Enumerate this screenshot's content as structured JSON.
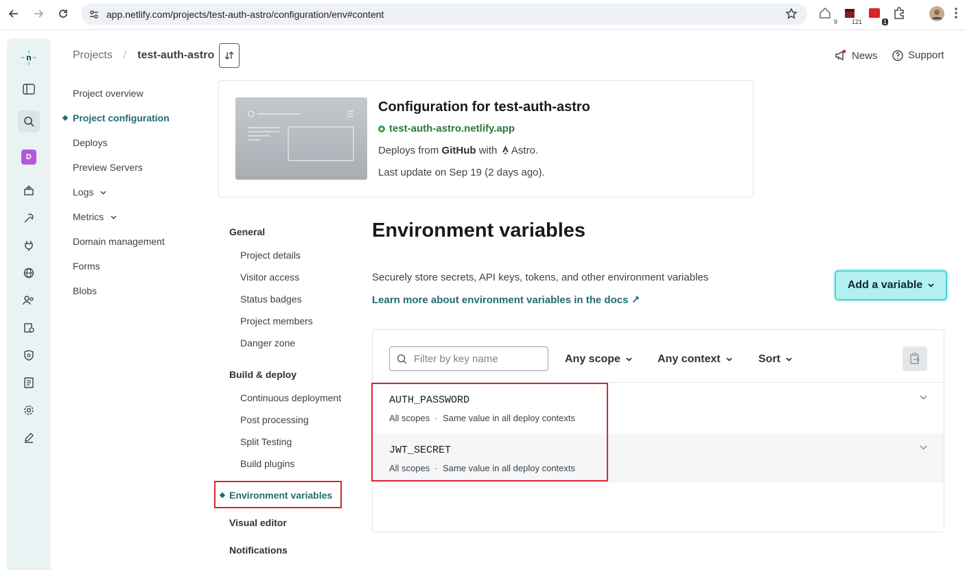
{
  "browser": {
    "url": "app.netlify.com/projects/test-auth-astro/configuration/env#content",
    "extensions": [
      {
        "name": "home-extension-icon",
        "badge": "9"
      },
      {
        "name": "calendar-extension-icon",
        "badge": "121"
      },
      {
        "name": "red-extension-icon",
        "badge": "1"
      },
      {
        "name": "puzzle-icon",
        "badge": ""
      }
    ]
  },
  "header": {
    "breadcrumb_root": "Projects",
    "breadcrumb_sep": "/",
    "breadcrumb_current": "test-auth-astro",
    "news": "News",
    "support": "Support"
  },
  "rail": {
    "avatar_letter": "D"
  },
  "leftnav": {
    "items": [
      {
        "label": "Project overview",
        "active": false
      },
      {
        "label": "Project configuration",
        "active": true
      },
      {
        "label": "Deploys",
        "active": false
      },
      {
        "label": "Preview Servers",
        "active": false
      },
      {
        "label": "Logs",
        "active": false,
        "dropdown": true
      },
      {
        "label": "Metrics",
        "active": false,
        "dropdown": true
      },
      {
        "label": "Domain management",
        "active": false
      },
      {
        "label": "Forms",
        "active": false
      },
      {
        "label": "Blobs",
        "active": false
      }
    ]
  },
  "config": {
    "title": "Configuration for test-auth-astro",
    "site": "test-auth-astro.netlify.app",
    "deploys_prefix": "Deploys from",
    "deploys_provider": "GitHub",
    "deploys_with": "with",
    "framework": "Astro.",
    "last_update": "Last update on Sep 19 (2 days ago)."
  },
  "subnav": {
    "general": "General",
    "general_items": [
      "Project details",
      "Visitor access",
      "Status badges",
      "Project members",
      "Danger zone"
    ],
    "build": "Build & deploy",
    "build_items": [
      "Continuous deployment",
      "Post processing",
      "Split Testing",
      "Build plugins"
    ],
    "env": "Environment variables",
    "visual": "Visual editor",
    "notifications": "Notifications"
  },
  "env": {
    "title": "Environment variables",
    "description": "Securely store secrets, API keys, tokens, and other environment variables",
    "docs_link": "Learn more about environment variables in the docs ↗",
    "add_button": "Add a variable",
    "filter_placeholder": "Filter by key name",
    "scope_dropdown": "Any scope",
    "context_dropdown": "Any context",
    "sort_dropdown": "Sort",
    "variables": [
      {
        "key": "AUTH_PASSWORD",
        "scopes": "All scopes",
        "dot": "·",
        "contexts": "Same value in all deploy contexts"
      },
      {
        "key": "JWT_SECRET",
        "scopes": "All scopes",
        "dot": "·",
        "contexts": "Same value in all deploy contexts"
      }
    ]
  },
  "colors": {
    "accent": "#236a74",
    "add_button_bg": "#b3f0f2",
    "highlight": "#d9252b",
    "rail_bg": "#eaf2f4"
  }
}
